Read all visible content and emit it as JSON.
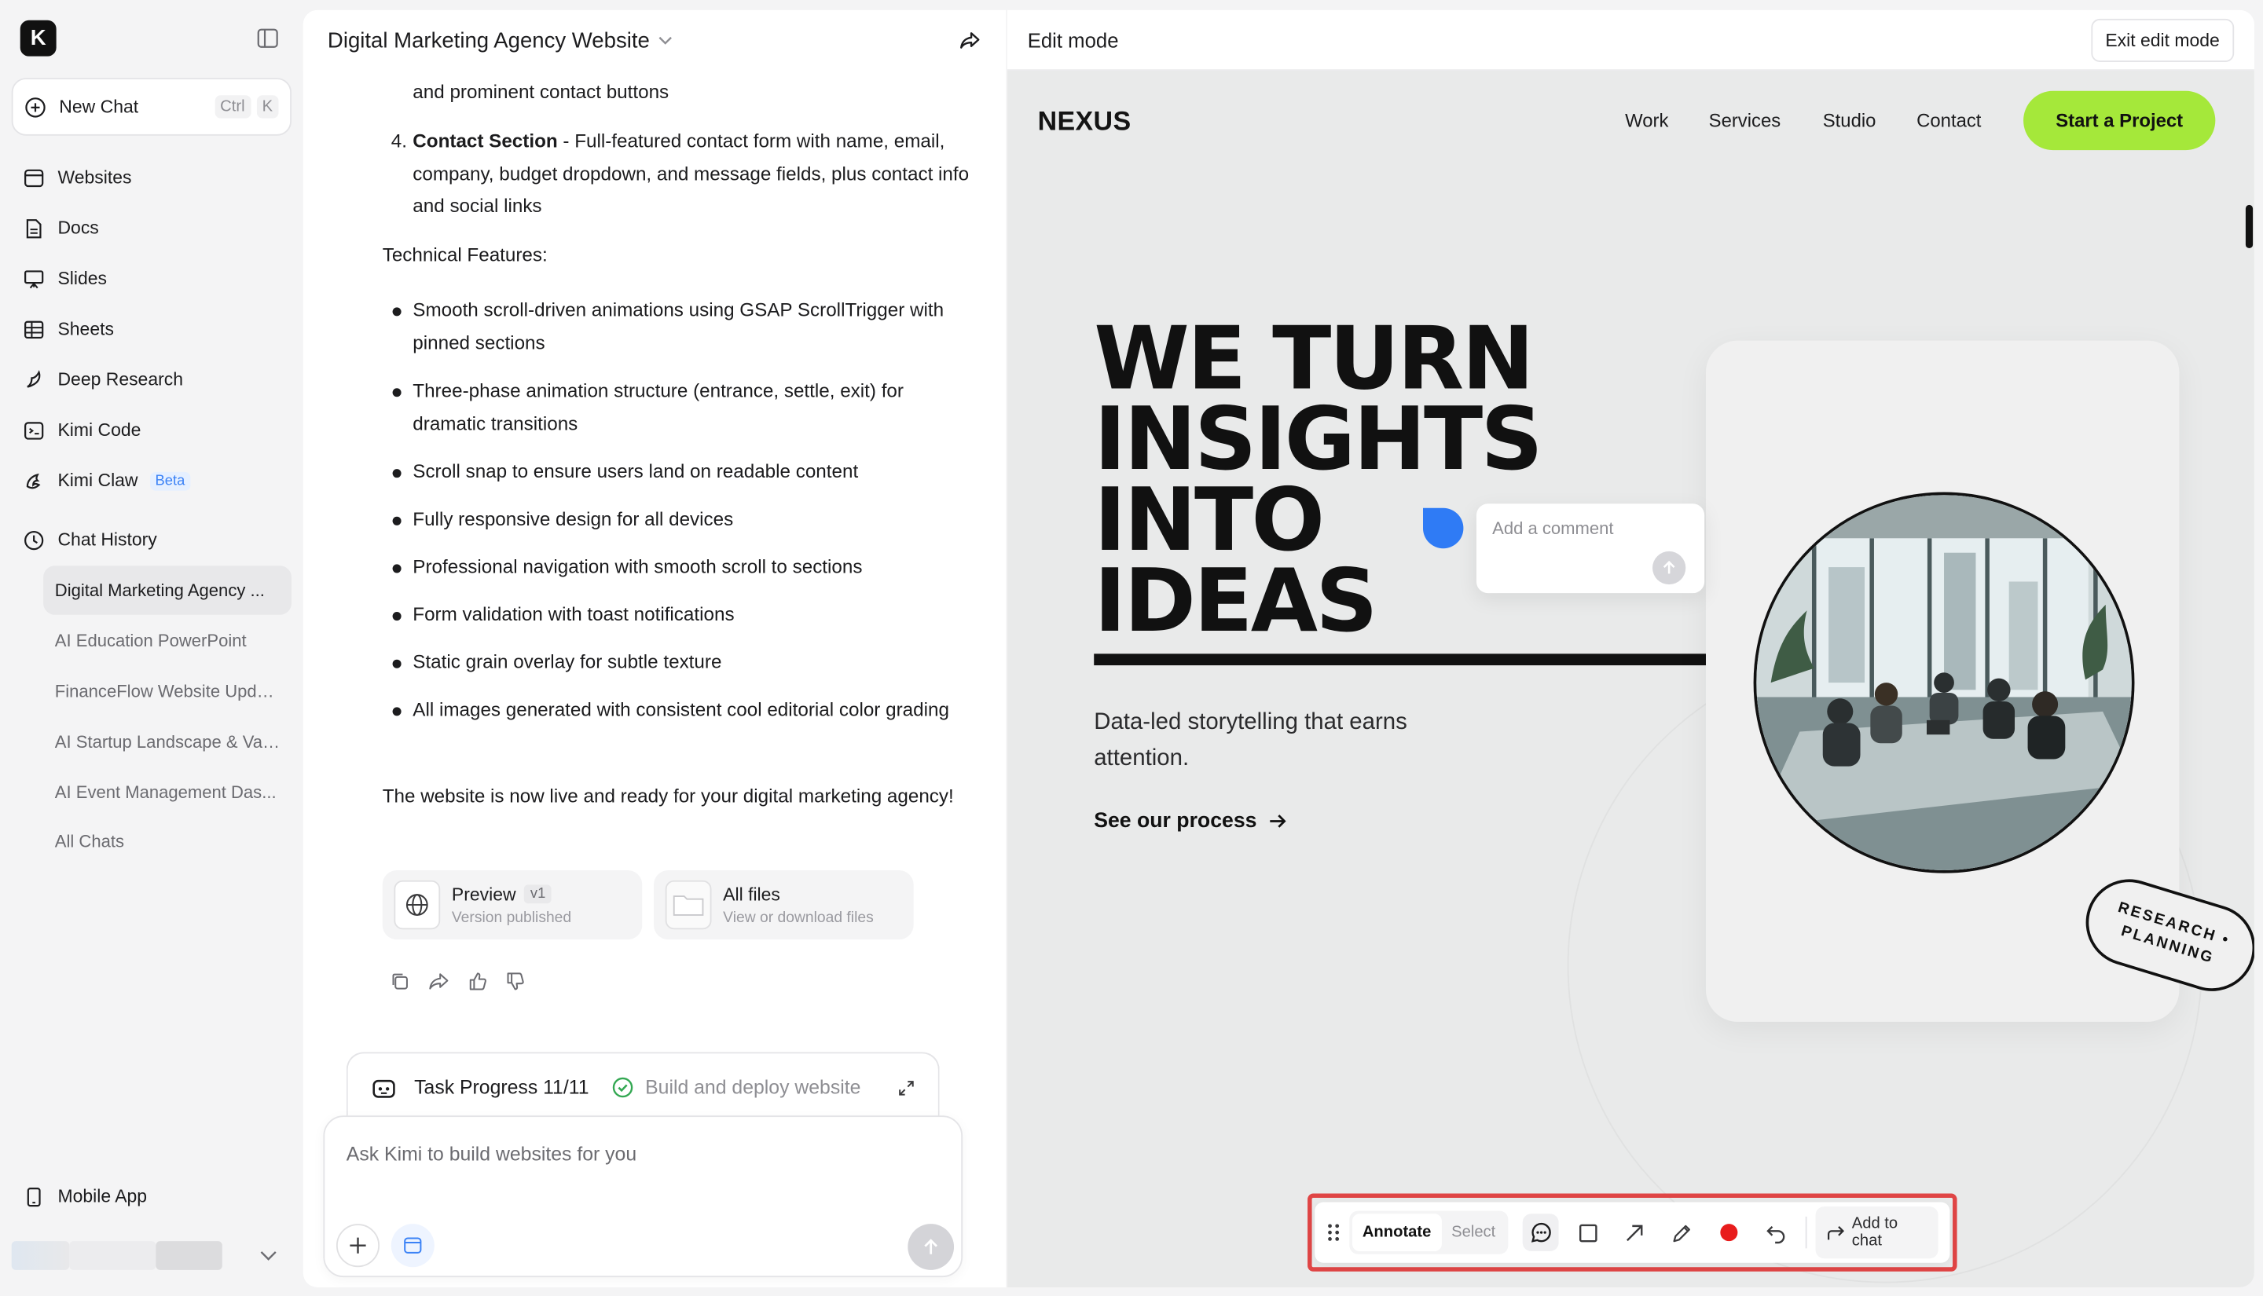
{
  "sidebar": {
    "logo_letter": "K",
    "new_chat": {
      "label": "New Chat",
      "shortcut": [
        "Ctrl",
        "K"
      ]
    },
    "nav": [
      {
        "label": "Websites",
        "icon": "browser-window-icon"
      },
      {
        "label": "Docs",
        "icon": "document-icon"
      },
      {
        "label": "Slides",
        "icon": "presentation-icon"
      },
      {
        "label": "Sheets",
        "icon": "table-icon"
      },
      {
        "label": "Deep Research",
        "icon": "research-icon"
      },
      {
        "label": "Kimi Code",
        "icon": "terminal-icon"
      },
      {
        "label": "Kimi Claw",
        "icon": "claw-icon",
        "badge": "Beta"
      }
    ],
    "history_header": "Chat History",
    "history": [
      "Digital Marketing Agency ...",
      "AI Education PowerPoint",
      "FinanceFlow Website Update",
      "AI Startup Landscape & Val...",
      "AI Event Management Das...",
      "All Chats"
    ],
    "mobile_app": "Mobile App"
  },
  "chat": {
    "title": "Digital Marketing Agency Website",
    "intro_line": "and prominent contact buttons",
    "item4": {
      "number": "4.",
      "bold": "Contact Section",
      "text": " - Full-featured contact form with name, email, company, budget dropdown, and message fields, plus contact info and social links"
    },
    "tech_title": "Technical Features:",
    "features": [
      "Smooth scroll-driven animations using GSAP ScrollTrigger with pinned sections",
      "Three-phase animation structure (entrance, settle, exit) for dramatic transitions",
      "Scroll snap to ensure users land on readable content",
      "Fully responsive design for all devices",
      "Professional navigation with smooth scroll to sections",
      "Form validation with toast notifications",
      "Static grain overlay for subtle texture",
      "All images generated with consistent cool editorial color grading"
    ],
    "closing": "The website is now live and ready for your digital marketing agency!",
    "cards": {
      "preview": {
        "title": "Preview",
        "version": "v1",
        "subtitle": "Version published"
      },
      "files": {
        "title": "All files",
        "subtitle": "View or download files"
      }
    },
    "task": {
      "label": "Task Progress 11/11",
      "status": "Build and deploy website"
    },
    "composer_placeholder": "Ask Kimi to build websites for you"
  },
  "preview": {
    "mode_title": "Edit mode",
    "exit_label": "Exit edit mode",
    "site": {
      "logo": "NEXUS",
      "nav": [
        "Work",
        "Services",
        "Studio",
        "Contact"
      ],
      "cta": "Start a Project",
      "hero": [
        "WE TURN",
        "INSIGHTS",
        "INTO",
        "IDEAS"
      ],
      "tagline": "Data-led storytelling that earns attention.",
      "process_link": "See our process",
      "stamp": [
        "RESEARCH •",
        "PLANNING"
      ]
    },
    "comment_placeholder": "Add a comment",
    "toolbar": {
      "annotate": "Annotate",
      "select": "Select",
      "add_to_chat": "Add to chat",
      "record_color": "#e81c1c"
    }
  },
  "colors": {
    "accent_green": "#a5e83a",
    "highlight_red": "#e04545",
    "comment_blue": "#2f7bf5"
  }
}
